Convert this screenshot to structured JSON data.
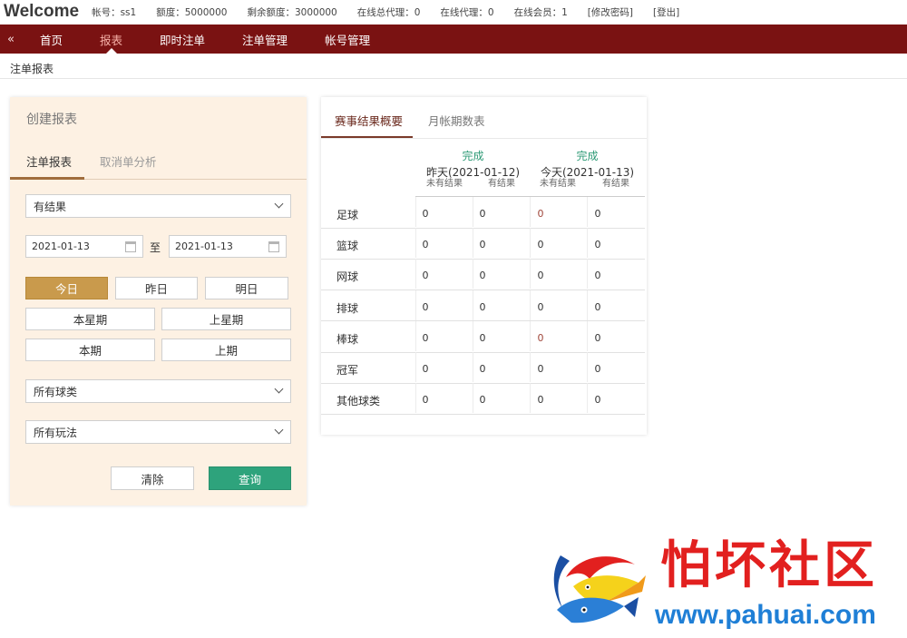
{
  "topbar": {
    "brand": "Welcome",
    "account": "帐号：ss1",
    "quota": "额度：5000000",
    "remaining": "剩余额度：3000000",
    "online_total_agents": "在线总代理：0",
    "online_agents": "在线代理：0",
    "online_members": "在线会员：1",
    "change_password": "[修改密码]",
    "logout": "[登出]"
  },
  "nav": {
    "collapse_icon": "«",
    "items": [
      "首页",
      "报表",
      "即时注单",
      "注单管理",
      "帐号管理"
    ],
    "active": "报表"
  },
  "breadcrumb": "注单报表",
  "create_report": {
    "title": "创建报表",
    "tabs": [
      "注单报表",
      "取消单分析"
    ],
    "active_tab": "注单报表",
    "result_select": "有结果",
    "date_from": "2021-01-13",
    "date_to_label": "至",
    "date_to": "2021-01-13",
    "quick_buttons": [
      "今日",
      "昨日",
      "明日",
      "本星期",
      "上星期",
      "本期",
      "上期"
    ],
    "selected_quick": "今日",
    "sport_select": "所有球类",
    "play_select": "所有玩法",
    "clear_label": "清除",
    "query_label": "查询"
  },
  "summary": {
    "tabs": [
      "赛事结果概要",
      "月帐期数表"
    ],
    "active_tab": "赛事结果概要",
    "columns": [
      {
        "status": "完成",
        "day": "昨天(2021-01-12)",
        "sub": [
          "未有结果",
          "有结果"
        ]
      },
      {
        "status": "完成",
        "day": "今天(2021-01-13)",
        "sub": [
          "未有结果",
          "有结果"
        ]
      }
    ],
    "rows": [
      {
        "sport": "足球",
        "values": [
          "0",
          "0",
          "0",
          "0"
        ]
      },
      {
        "sport": "篮球",
        "values": [
          "0",
          "0",
          "0",
          "0"
        ]
      },
      {
        "sport": "网球",
        "values": [
          "0",
          "0",
          "0",
          "0"
        ]
      },
      {
        "sport": "排球",
        "values": [
          "0",
          "0",
          "0",
          "0"
        ]
      },
      {
        "sport": "棒球",
        "values": [
          "0",
          "0",
          "0",
          "0"
        ]
      },
      {
        "sport": "冠军",
        "values": [
          "0",
          "0",
          "0",
          "0"
        ]
      },
      {
        "sport": "其他球类",
        "values": [
          "0",
          "0",
          "0",
          "0"
        ]
      }
    ]
  },
  "watermark": {
    "title": "怕坏社区",
    "url": "www.pahuai.com"
  },
  "colors": {
    "nav_bg": "#7a1212",
    "active_nav_text": "#f7b1a8",
    "panel_bg": "#fdf1e3",
    "selected_button": "#c99a4c",
    "query_button": "#2ea37c",
    "status_green": "#2e9a76",
    "watermark_red": "#e2201f",
    "watermark_blue": "#1f7fd6"
  }
}
